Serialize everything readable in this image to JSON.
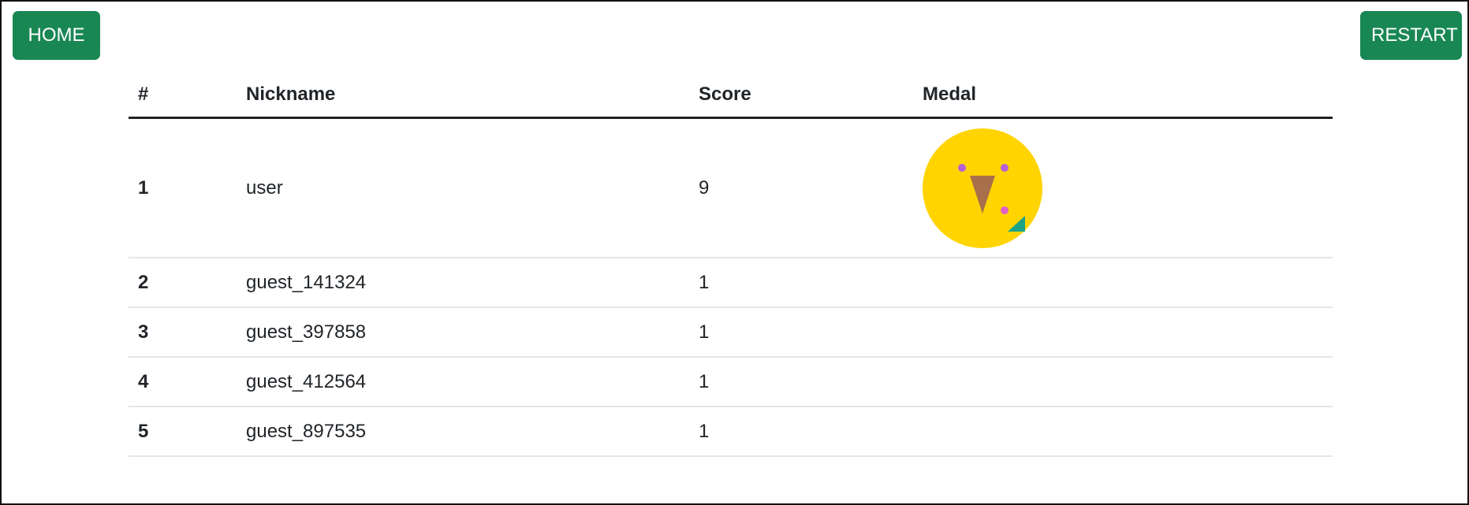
{
  "toolbar": {
    "home_label": "HOME",
    "restart_label": "RESTART"
  },
  "colors": {
    "button_bg": "#198754",
    "medal_gold": "#FFD400"
  },
  "table": {
    "headers": {
      "rank": "#",
      "nickname": "Nickname",
      "score": "Score",
      "medal": "Medal"
    },
    "rows": [
      {
        "rank": "1",
        "nickname": "user",
        "score": "9",
        "medal": "gold-medal-icon"
      },
      {
        "rank": "2",
        "nickname": "guest_141324",
        "score": "1",
        "medal": ""
      },
      {
        "rank": "3",
        "nickname": "guest_397858",
        "score": "1",
        "medal": ""
      },
      {
        "rank": "4",
        "nickname": "guest_412564",
        "score": "1",
        "medal": ""
      },
      {
        "rank": "5",
        "nickname": "guest_897535",
        "score": "1",
        "medal": ""
      }
    ]
  }
}
